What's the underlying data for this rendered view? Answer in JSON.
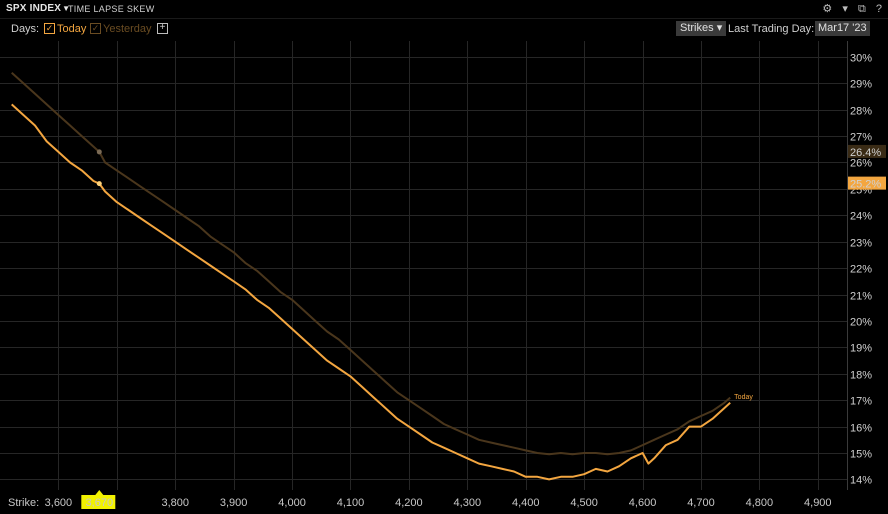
{
  "header": {
    "ticker": "SPX INDEX",
    "subtitle": "TIME LAPSE SKEW",
    "icons": [
      "gear-icon",
      "dropdown-caret-icon",
      "external-window-icon",
      "help-icon"
    ]
  },
  "toolbar": {
    "days_label": "Days:",
    "today_label": "Today",
    "yesterday_label": "Yesterday",
    "add_symbol": "+",
    "strikes_label": "Strikes",
    "last_trading_day_label": "Last Trading Day:",
    "last_trading_day_value": "Mar17 '23"
  },
  "colors": {
    "today": "#f3a640",
    "yesterday": "#4a361c",
    "grid": "#262626",
    "background": "#000000"
  },
  "chart_data": {
    "type": "line",
    "xlabel": "Strike:",
    "ylabel": "",
    "xlim": [
      3500,
      4950
    ],
    "ylim": [
      13.6,
      30.6
    ],
    "x_ticks": [
      3600,
      3700,
      3800,
      3900,
      4000,
      4100,
      4200,
      4300,
      4400,
      4500,
      4600,
      4700,
      4800,
      4900
    ],
    "x_tick_labels": [
      "3,600",
      "3,670",
      "3,800",
      "3,900",
      "4,000",
      "4,100",
      "4,200",
      "4,300",
      "4,400",
      "4,500",
      "4,600",
      "4,700",
      "4,800",
      "4,900"
    ],
    "y_ticks": [
      14,
      15,
      16,
      17,
      18,
      19,
      20,
      21,
      22,
      23,
      24,
      25,
      26,
      27,
      28,
      29,
      30
    ],
    "y_tick_labels": [
      "14%",
      "15%",
      "16%",
      "17%",
      "18%",
      "19%",
      "20%",
      "21%",
      "22%",
      "23%",
      "24%",
      "25%",
      "26%",
      "27%",
      "28%",
      "29%",
      "30%"
    ],
    "cursor": {
      "strike": 3670,
      "label": "3,670",
      "today_value": "25.2%",
      "yesterday_value": "26.4%"
    },
    "series": [
      {
        "name": "Today",
        "x": [
          3520,
          3540,
          3560,
          3580,
          3600,
          3620,
          3640,
          3660,
          3670,
          3680,
          3700,
          3720,
          3740,
          3760,
          3780,
          3800,
          3820,
          3840,
          3860,
          3880,
          3900,
          3920,
          3940,
          3960,
          3980,
          4000,
          4020,
          4040,
          4060,
          4080,
          4100,
          4120,
          4140,
          4160,
          4180,
          4200,
          4220,
          4240,
          4260,
          4280,
          4300,
          4320,
          4340,
          4360,
          4380,
          4400,
          4420,
          4440,
          4460,
          4480,
          4500,
          4520,
          4540,
          4560,
          4580,
          4600,
          4610,
          4620,
          4640,
          4660,
          4680,
          4700,
          4720,
          4740,
          4750
        ],
        "values": [
          28.2,
          27.8,
          27.4,
          26.8,
          26.4,
          26.0,
          25.7,
          25.3,
          25.2,
          24.9,
          24.5,
          24.2,
          23.9,
          23.6,
          23.3,
          23.0,
          22.7,
          22.4,
          22.1,
          21.8,
          21.5,
          21.2,
          20.8,
          20.5,
          20.1,
          19.7,
          19.3,
          18.9,
          18.5,
          18.2,
          17.9,
          17.5,
          17.1,
          16.7,
          16.3,
          16.0,
          15.7,
          15.4,
          15.2,
          15.0,
          14.8,
          14.6,
          14.5,
          14.4,
          14.3,
          14.1,
          14.1,
          14.0,
          14.1,
          14.1,
          14.2,
          14.4,
          14.3,
          14.5,
          14.8,
          15.0,
          14.6,
          14.8,
          15.3,
          15.5,
          16.0,
          16.0,
          16.3,
          16.7,
          16.9
        ]
      },
      {
        "name": "Yesterday",
        "x": [
          3520,
          3540,
          3560,
          3580,
          3600,
          3620,
          3640,
          3660,
          3670,
          3680,
          3700,
          3720,
          3740,
          3760,
          3780,
          3800,
          3820,
          3840,
          3860,
          3880,
          3900,
          3920,
          3940,
          3960,
          3980,
          4000,
          4020,
          4040,
          4060,
          4080,
          4100,
          4120,
          4140,
          4160,
          4180,
          4200,
          4220,
          4240,
          4260,
          4280,
          4300,
          4320,
          4340,
          4360,
          4380,
          4400,
          4420,
          4440,
          4460,
          4480,
          4500,
          4520,
          4540,
          4560,
          4580,
          4600,
          4620,
          4640,
          4660,
          4680,
          4700,
          4720,
          4740,
          4750
        ],
        "values": [
          29.4,
          29.0,
          28.6,
          28.2,
          27.8,
          27.4,
          27.0,
          26.6,
          26.4,
          26.0,
          25.7,
          25.4,
          25.1,
          24.8,
          24.5,
          24.2,
          23.9,
          23.6,
          23.2,
          22.9,
          22.6,
          22.2,
          21.9,
          21.5,
          21.1,
          20.8,
          20.4,
          20.0,
          19.6,
          19.3,
          18.9,
          18.5,
          18.1,
          17.7,
          17.3,
          17.0,
          16.7,
          16.4,
          16.1,
          15.9,
          15.7,
          15.5,
          15.4,
          15.3,
          15.2,
          15.1,
          15.0,
          14.95,
          15.0,
          14.95,
          15.0,
          15.0,
          14.95,
          15.0,
          15.1,
          15.3,
          15.5,
          15.7,
          15.9,
          16.2,
          16.4,
          16.6,
          16.9,
          17.1
        ]
      }
    ],
    "annotations": [
      "Today"
    ],
    "grid": true,
    "legend": "none"
  }
}
